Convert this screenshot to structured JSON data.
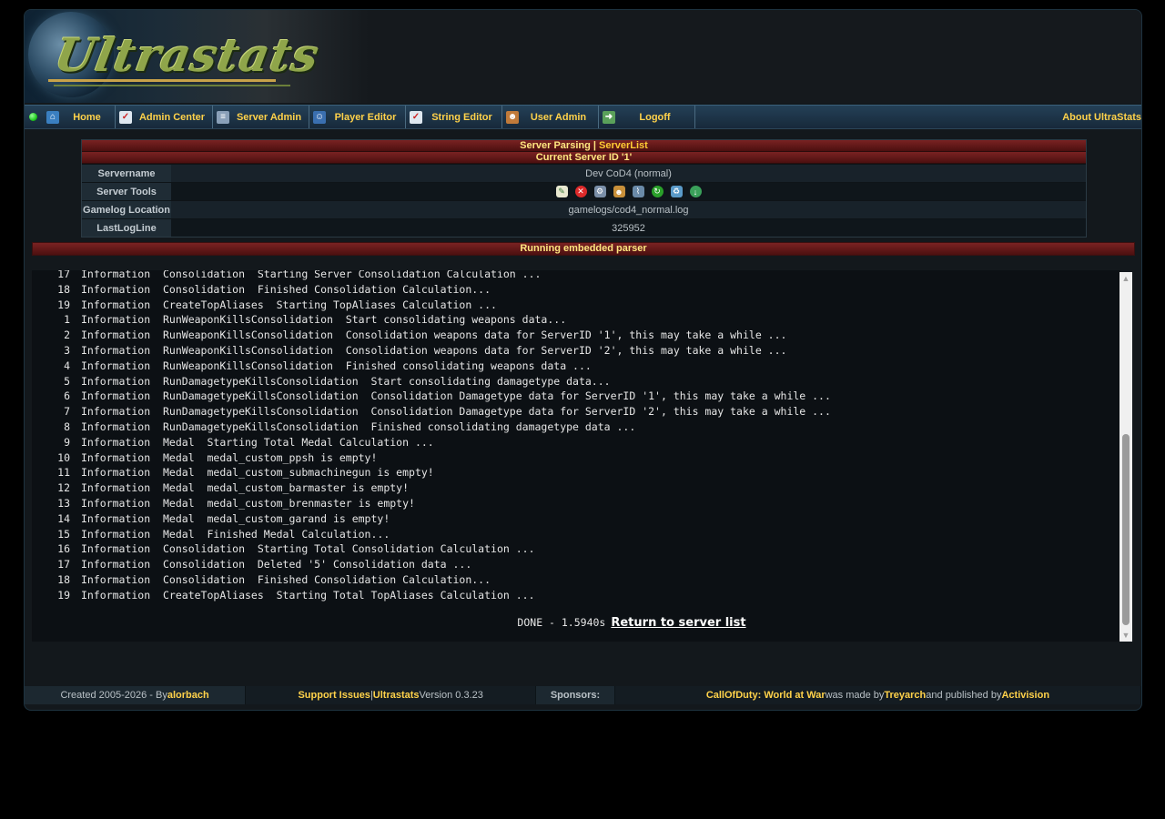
{
  "banner": {
    "logo_text": "Ultrastats"
  },
  "nav": {
    "items": [
      {
        "label": "Home"
      },
      {
        "label": "Admin Center"
      },
      {
        "label": "Server Admin"
      },
      {
        "label": "Player Editor"
      },
      {
        "label": "String Editor"
      },
      {
        "label": "User Admin"
      },
      {
        "label": "Logoff"
      }
    ],
    "about": "About UltraStats"
  },
  "server_info": {
    "header_prefix": "Server Parsing | ",
    "header_link": "ServerList",
    "subheader": "Current Server ID '1'",
    "rows": [
      {
        "label": "Servername",
        "value": "Dev CoD4 (normal)"
      },
      {
        "label": "Server Tools",
        "value": ""
      },
      {
        "label": "Gamelog Location",
        "value": "gamelogs/cod4_normal.log"
      },
      {
        "label": "LastLogLine",
        "value": "325952"
      }
    ],
    "tool_icons": [
      "edit-icon",
      "delete-icon",
      "settings-icon",
      "users-icon",
      "chart-icon",
      "refresh-icon",
      "trash-icon",
      "download-icon"
    ]
  },
  "parser": {
    "title": "Running embedded parser",
    "log": [
      {
        "num": "17",
        "text": "Information  Consolidation  Starting Server Consolidation Calculation ..."
      },
      {
        "num": "18",
        "text": "Information  Consolidation  Finished Consolidation Calculation..."
      },
      {
        "num": "19",
        "text": "Information  CreateTopAliases  Starting TopAliases Calculation ..."
      },
      {
        "num": "1",
        "text": "Information  RunWeaponKillsConsolidation  Start consolidating weapons data..."
      },
      {
        "num": "2",
        "text": "Information  RunWeaponKillsConsolidation  Consolidation weapons data for ServerID '1', this may take a while ..."
      },
      {
        "num": "3",
        "text": "Information  RunWeaponKillsConsolidation  Consolidation weapons data for ServerID '2', this may take a while ..."
      },
      {
        "num": "4",
        "text": "Information  RunWeaponKillsConsolidation  Finished consolidating weapons data ..."
      },
      {
        "num": "5",
        "text": "Information  RunDamagetypeKillsConsolidation  Start consolidating damagetype data..."
      },
      {
        "num": "6",
        "text": "Information  RunDamagetypeKillsConsolidation  Consolidation Damagetype data for ServerID '1', this may take a while ..."
      },
      {
        "num": "7",
        "text": "Information  RunDamagetypeKillsConsolidation  Consolidation Damagetype data for ServerID '2', this may take a while ..."
      },
      {
        "num": "8",
        "text": "Information  RunDamagetypeKillsConsolidation  Finished consolidating damagetype data ..."
      },
      {
        "num": "9",
        "text": "Information  Medal  Starting Total Medal Calculation ..."
      },
      {
        "num": "10",
        "text": "Information  Medal  medal_custom_ppsh is empty!"
      },
      {
        "num": "11",
        "text": "Information  Medal  medal_custom_submachinegun is empty!"
      },
      {
        "num": "12",
        "text": "Information  Medal  medal_custom_barmaster is empty!"
      },
      {
        "num": "13",
        "text": "Information  Medal  medal_custom_brenmaster is empty!"
      },
      {
        "num": "14",
        "text": "Information  Medal  medal_custom_garand is empty!"
      },
      {
        "num": "15",
        "text": "Information  Medal  Finished Medal Calculation..."
      },
      {
        "num": "16",
        "text": "Information  Consolidation  Starting Total Consolidation Calculation ..."
      },
      {
        "num": "17",
        "text": "Information  Consolidation  Deleted '5' Consolidation data ..."
      },
      {
        "num": "18",
        "text": "Information  Consolidation  Finished Consolidation Calculation..."
      },
      {
        "num": "19",
        "text": "Information  CreateTopAliases  Starting Total TopAliases Calculation ..."
      }
    ],
    "done_text": "DONE - 1.5940s",
    "return_link": "Return to server list"
  },
  "footer": {
    "created": "Created 2005-2026 - By ",
    "author": "alorbach",
    "support": "Support Issues",
    "sep": " | ",
    "product": "Ultrastats",
    "version": " Version 0.3.23",
    "sponsors": "Sponsors:",
    "game": "CallOfDuty: World at War",
    "made_by": " was made by ",
    "dev": "Treyarch",
    "published": " and published by ",
    "publisher": "Activision"
  }
}
